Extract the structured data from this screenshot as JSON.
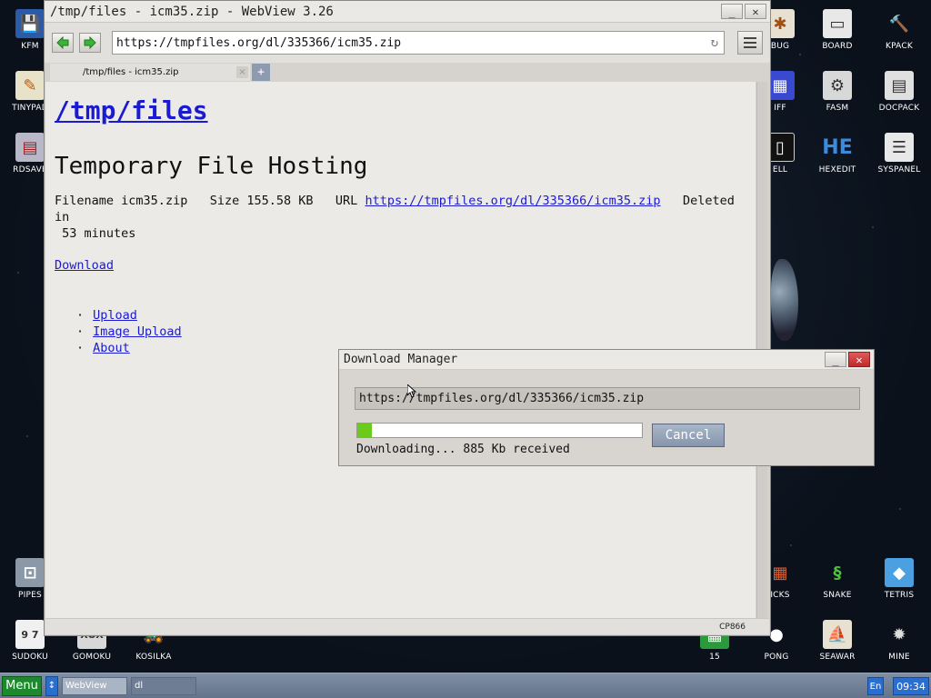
{
  "window": {
    "title": "/tmp/files - icm35.zip - WebView 3.26",
    "controls": {
      "minimize": "_",
      "close": "✕"
    }
  },
  "toolbar": {
    "url": "https://tmpfiles.org/dl/335366/icm35.zip"
  },
  "tabs": [
    {
      "label": "/tmp/files - icm35.zip",
      "close": "×"
    }
  ],
  "new_tab_label": "+",
  "page": {
    "site_title": "/tmp/files",
    "heading": "Temporary File Hosting",
    "info": {
      "filename_label": "Filename",
      "filename": "icm35.zip",
      "size_label": "Size",
      "size": "155.58 KB",
      "url_label": "URL",
      "url": "https://tmpfiles.org/dl/335366/icm35.zip",
      "deleted_label": "Deleted in",
      "deleted_value": "53 minutes"
    },
    "download_link": "Download",
    "nav_links": [
      "Upload",
      "Image Upload",
      "About"
    ]
  },
  "statusbar": {
    "encoding": "CP866"
  },
  "download_manager": {
    "title": "Download Manager",
    "url": "https://tmpfiles.org/dl/335366/icm35.zip",
    "progress_fraction": 0.05,
    "status": "Downloading... 885 Kb received",
    "cancel_label": "Cancel"
  },
  "desktop_icons": {
    "left": [
      "KFM",
      "TINYPAD",
      "RDSAVE",
      "PIPES",
      "SUDOKU",
      "GOMOKU",
      "KOSILKA"
    ],
    "right": [
      "BUG",
      "BOARD",
      "KPACK",
      "IFF",
      "FASM",
      "DOCPACK",
      "ELL",
      "HEXEDIT",
      "SYSPANEL",
      "ICKS",
      "SNAKE",
      "TETRIS",
      "15",
      "PONG",
      "SEAWAR",
      "MINE"
    ]
  },
  "taskbar": {
    "menu_label": "Menu",
    "arrow": "↕",
    "items": [
      "WebView",
      "dl"
    ],
    "language": "En",
    "clock": "09:34"
  },
  "colors": {
    "progress": "#6acb1a",
    "link": "#1a1ad0",
    "menu_button": "#1c8a2c",
    "taskbar_accent": "#2a6fd0"
  }
}
